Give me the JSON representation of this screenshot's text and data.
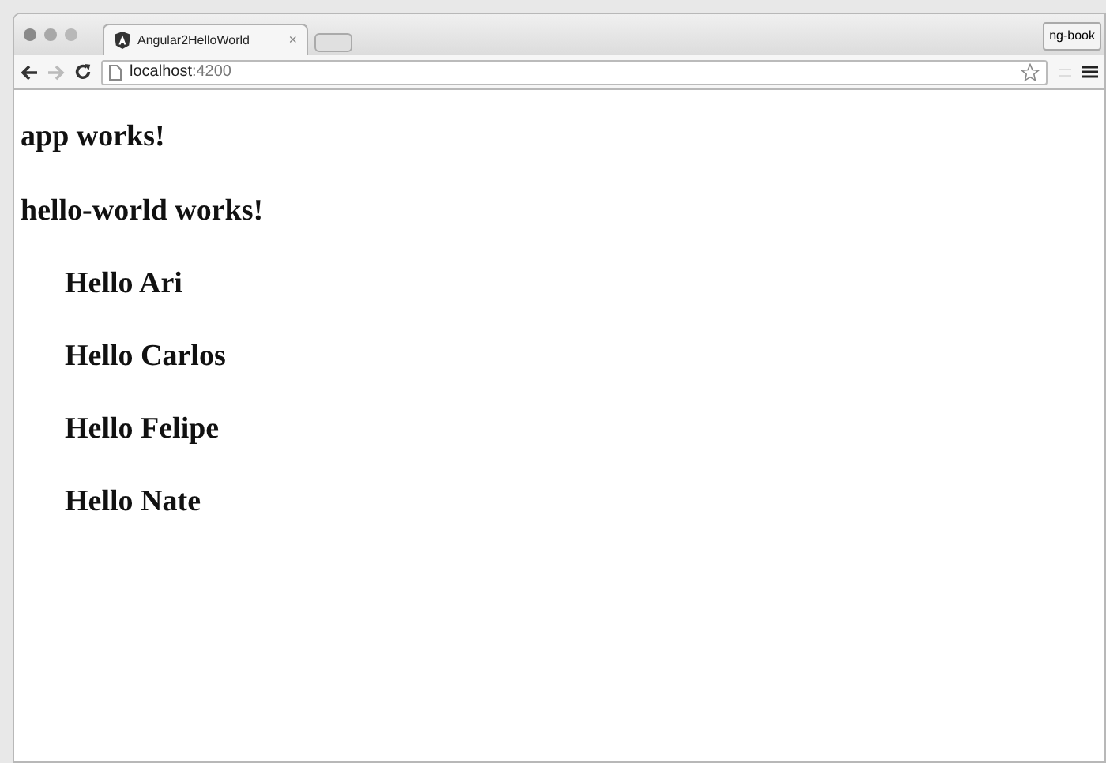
{
  "browser": {
    "tab": {
      "title": "Angular2HelloWorld",
      "close": "×"
    },
    "profile": "ng-book",
    "url": {
      "host": "localhost",
      "port": ":4200"
    }
  },
  "page": {
    "app_heading": "app works!",
    "component_heading": "hello-world works!",
    "greetings": [
      "Hello Ari",
      "Hello Carlos",
      "Hello Felipe",
      "Hello Nate"
    ]
  }
}
